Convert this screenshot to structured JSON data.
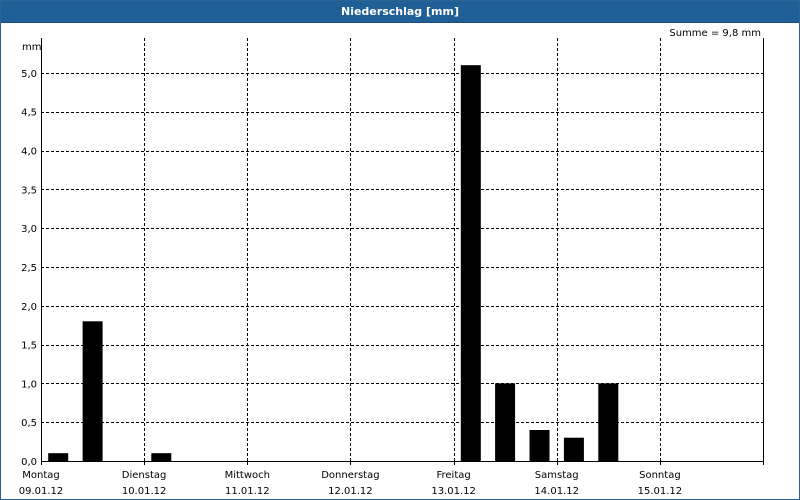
{
  "title": "Niederschlag [mm]",
  "sum_label": "Summe = 9,8 mm",
  "colors": {
    "titlebar": "#1f5f95",
    "bar": "#000000",
    "grid": "#000000"
  },
  "chart_data": {
    "type": "bar",
    "title": "Niederschlag [mm]",
    "ylabel": "mm",
    "ylim": [
      0,
      5.45
    ],
    "grid": true,
    "yticks": [
      0,
      0.5,
      1.0,
      1.5,
      2.0,
      2.5,
      3.0,
      3.5,
      4.0,
      4.5,
      5.0
    ],
    "ytick_labels": [
      "0,0",
      "0,5",
      "1,0",
      "1,5",
      "2,0",
      "2,5",
      "3,0",
      "3,5",
      "4,0",
      "4,5",
      "5,0"
    ],
    "days": [
      {
        "name": "Montag",
        "date": "09.01.12"
      },
      {
        "name": "Dienstag",
        "date": "10.01.12"
      },
      {
        "name": "Mittwoch",
        "date": "11.01.12"
      },
      {
        "name": "Donnerstag",
        "date": "12.01.12"
      },
      {
        "name": "Freitag",
        "date": "13.01.12"
      },
      {
        "name": "Samstag",
        "date": "14.01.12"
      },
      {
        "name": "Sonntag",
        "date": "15.01.12"
      }
    ],
    "bars_per_day": 3,
    "values": [
      0.1,
      1.8,
      0,
      0.1,
      0,
      0,
      0,
      0,
      0,
      0,
      0,
      0,
      5.1,
      1.0,
      0.4,
      0.3,
      1.0,
      0,
      0,
      0,
      0
    ]
  }
}
